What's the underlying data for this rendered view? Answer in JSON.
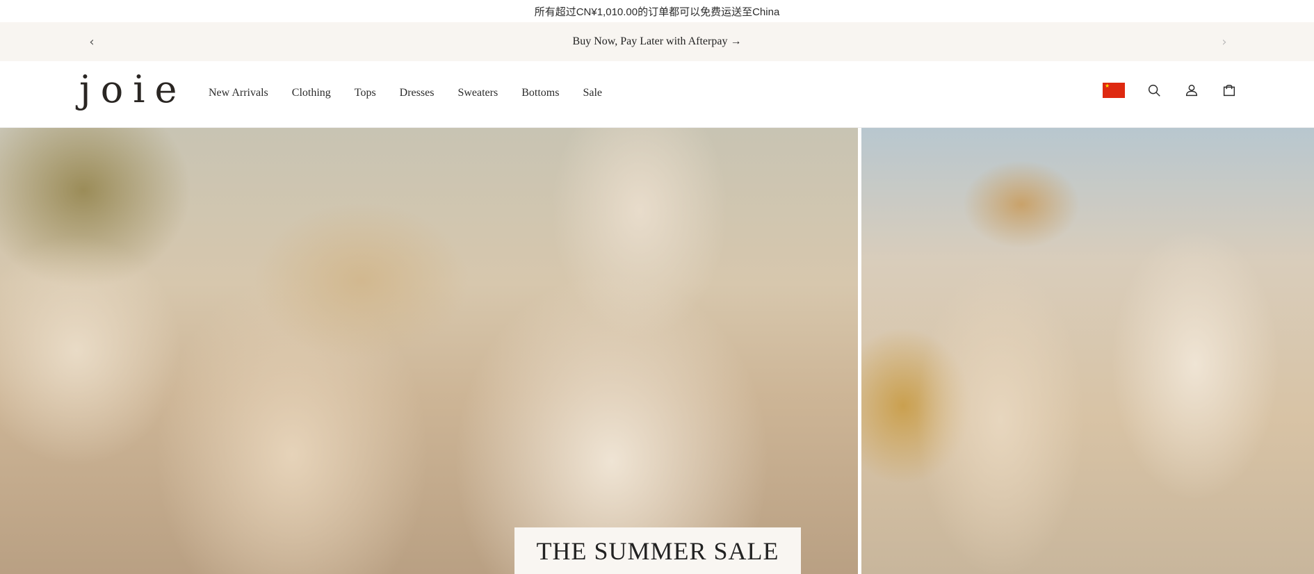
{
  "shipping_bar": {
    "text": "所有超过CN¥1,010.00的订单都可以免费运送至China"
  },
  "promo_bar": {
    "text": "Buy Now, Pay Later with Afterpay →",
    "prev_icon": "chevron-left-icon",
    "next_icon": "chevron-right-icon"
  },
  "header": {
    "logo": "joie",
    "nav": [
      {
        "label": "New Arrivals"
      },
      {
        "label": "Clothing"
      },
      {
        "label": "Tops"
      },
      {
        "label": "Dresses"
      },
      {
        "label": "Sweaters"
      },
      {
        "label": "Bottoms"
      },
      {
        "label": "Sale"
      }
    ],
    "icons": [
      "china-flag-icon",
      "search-icon",
      "account-icon",
      "cart-icon"
    ]
  },
  "hero": {
    "sale_title": "THE SUMMER SALE"
  },
  "colors": {
    "promo_background": "#f8f5f1",
    "flag_red": "#de2910",
    "flag_yellow": "#ffde00",
    "sale_card_background": "#f9f6f2"
  }
}
